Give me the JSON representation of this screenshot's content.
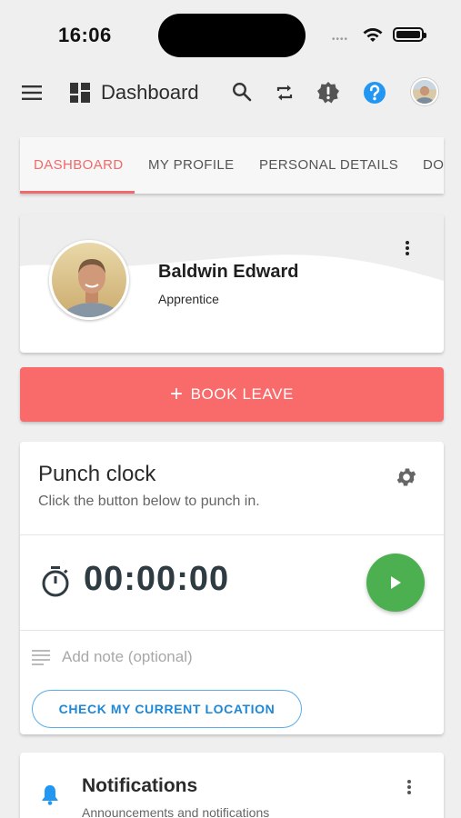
{
  "status_bar": {
    "time": "16:06",
    "signal_dots": "•••• "
  },
  "app_bar": {
    "title": "Dashboard",
    "icons": [
      "menu-icon",
      "dashboard-icon",
      "search-icon",
      "swap-icon",
      "alert-badge-icon",
      "help-icon",
      "user-avatar"
    ]
  },
  "tabs": [
    {
      "label": "DASHBOARD",
      "active": true
    },
    {
      "label": "MY PROFILE",
      "active": false
    },
    {
      "label": "PERSONAL DETAILS",
      "active": false
    },
    {
      "label": "DO",
      "active": false
    }
  ],
  "profile": {
    "name": "Baldwin Edward",
    "role": "Apprentice"
  },
  "book_leave": {
    "icon": "+",
    "label": "BOOK LEAVE"
  },
  "punch_clock": {
    "title": "Punch clock",
    "subtitle": "Click the button below to punch in.",
    "timer": "00:00:00",
    "note_placeholder": "Add note (optional)",
    "location_button": "CHECK MY CURRENT LOCATION"
  },
  "notifications": {
    "title": "Notifications",
    "subtitle": "Announcements and notifications"
  },
  "colors": {
    "accent_red": "#f96a6a",
    "tab_active": "#ef6b6b",
    "play_green": "#4caf50",
    "link_blue": "#1e88d6",
    "help_blue": "#2196f3"
  }
}
